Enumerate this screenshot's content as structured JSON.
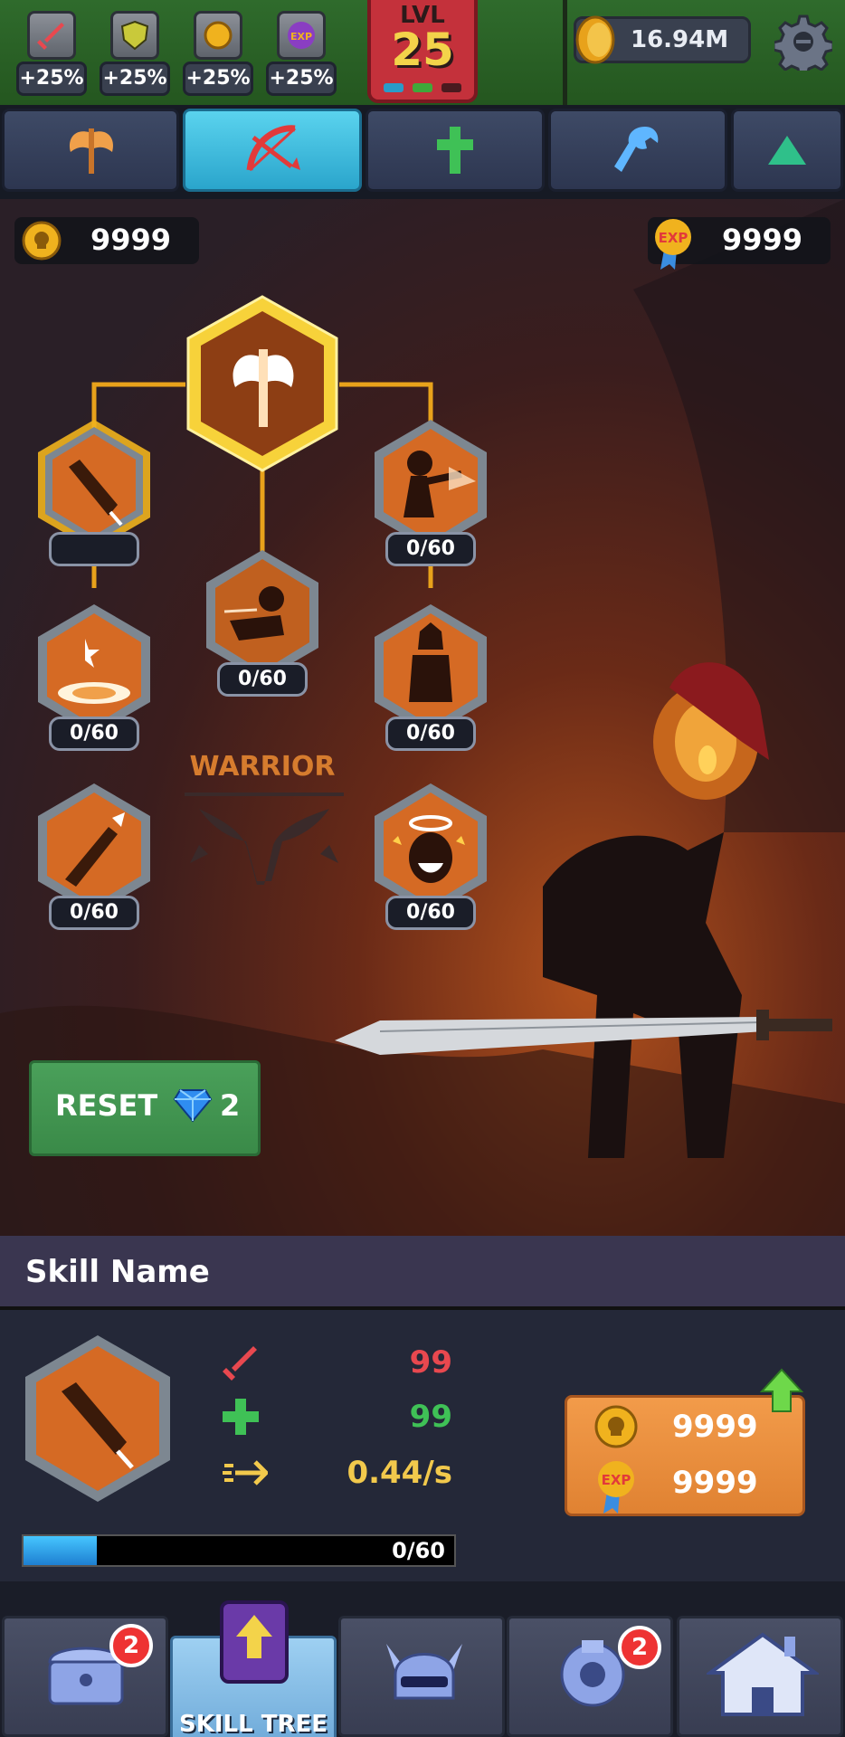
{
  "hud": {
    "buffs": [
      {
        "icon": "sword-icon",
        "value": "+25%"
      },
      {
        "icon": "shield-icon",
        "value": "+25%"
      },
      {
        "icon": "coin-icon",
        "value": "+25%"
      },
      {
        "icon": "exp-icon",
        "value": "+25%"
      }
    ],
    "level_label": "LVL",
    "level_value": "25",
    "coins": "16.94M"
  },
  "tabs": [
    {
      "icon": "axe-icon",
      "active": false
    },
    {
      "icon": "bow-icon",
      "active": true
    },
    {
      "icon": "healing-icon",
      "active": false
    },
    {
      "icon": "wrench-icon",
      "active": false
    },
    {
      "icon": "triangle-up-icon",
      "active": false
    }
  ],
  "resources": {
    "gold": "9999",
    "exp_label": "EXP",
    "exp": "9999"
  },
  "tree": {
    "class_name": "WARRIOR",
    "nodes": [
      {
        "id": "root",
        "icon": "axe-icon",
        "count": ""
      },
      {
        "id": "sword-slash",
        "icon": "sword-slash-icon",
        "count": ""
      },
      {
        "id": "stickman-punch",
        "icon": "punch-icon",
        "count": "0/60"
      },
      {
        "id": "dash",
        "icon": "dash-icon",
        "count": "0/60"
      },
      {
        "id": "shockwave",
        "icon": "shockwave-icon",
        "count": "0/60"
      },
      {
        "id": "rage",
        "icon": "rage-icon",
        "count": "0/60"
      },
      {
        "id": "sword-strike",
        "icon": "sword-strike-icon",
        "count": "0/60"
      },
      {
        "id": "halo",
        "icon": "halo-icon",
        "count": "0/60"
      }
    ]
  },
  "reset": {
    "label": "RESET",
    "cost": "2"
  },
  "skill": {
    "name": "Skill Name",
    "attack": "99",
    "health": "99",
    "speed": "0.44/s",
    "progress_text": "0/60",
    "progress": 0.17,
    "cost_gold": "9999",
    "cost_exp_label": "EXP",
    "cost_exp": "9999"
  },
  "nav": {
    "chest_badge": "2",
    "skill_tree_label": "SKILL TREE",
    "ring_badge": "2"
  },
  "colors": {
    "attack": "#e8484f",
    "health": "#3fc156",
    "speed": "#f2c94c",
    "accent": "#f0b21e"
  }
}
